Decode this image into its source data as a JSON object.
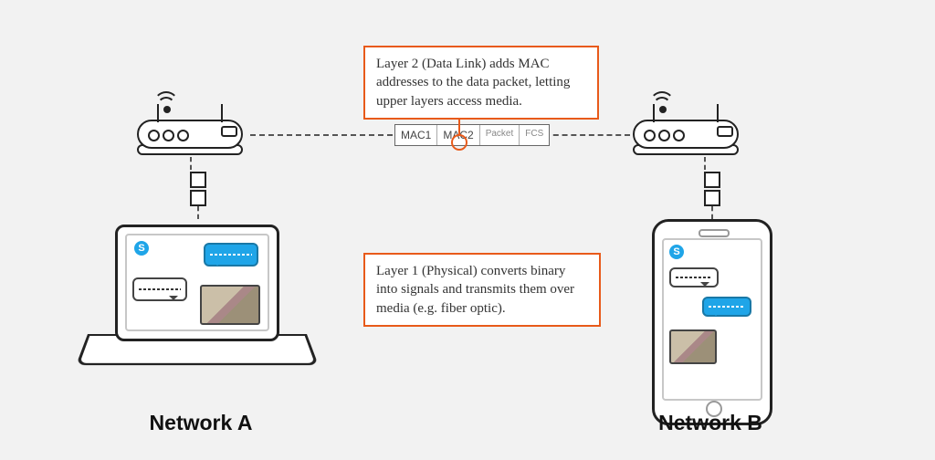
{
  "callouts": {
    "layer2": "Layer 2 (Data Link) adds MAC addresses to the data packet, letting upper layers access media.",
    "layer1": "Layer 1 (Physical) converts binary into signals and transmits them over media (e.g. fiber optic)."
  },
  "packet": {
    "cells": [
      "MAC1",
      "MAC2",
      "Packet",
      "FCS"
    ]
  },
  "labels": {
    "networkA": "Network A",
    "networkB": "Network B"
  },
  "icons": {
    "skype_glyph": "S"
  }
}
